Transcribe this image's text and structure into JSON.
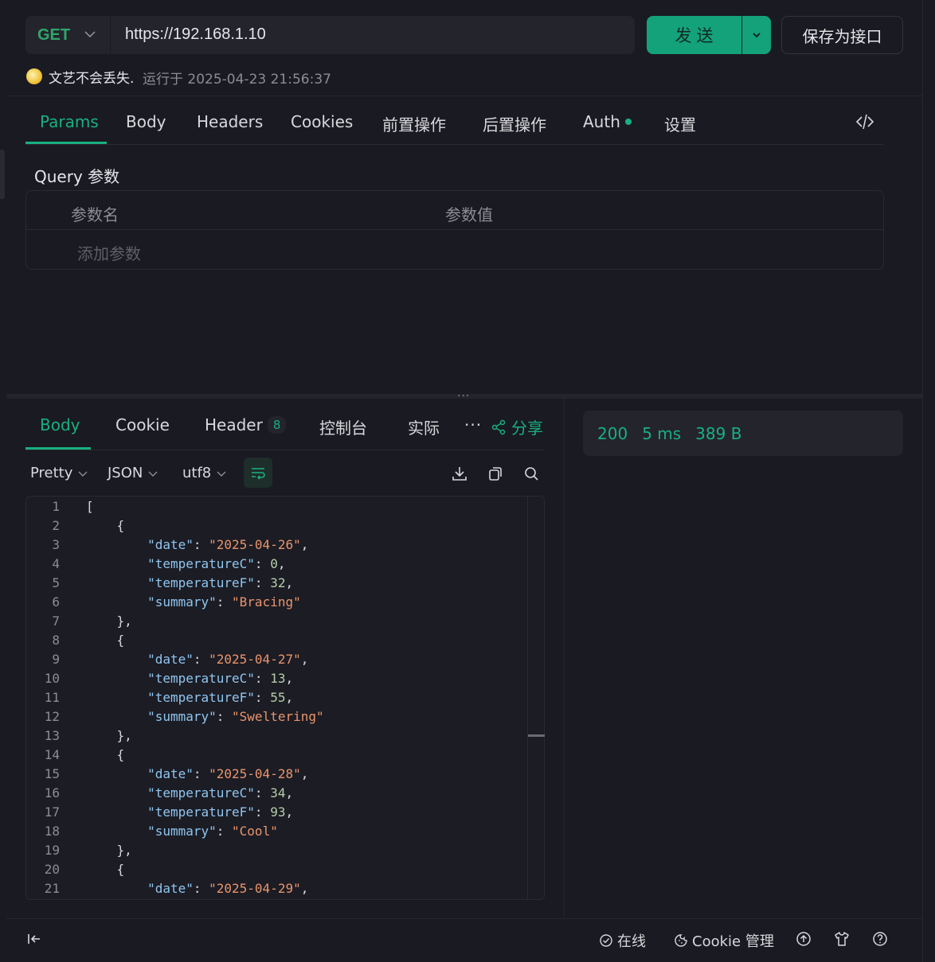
{
  "request": {
    "method": "GET",
    "url": "https://192.168.1.10",
    "send_label": "发送",
    "save_label": "保存为接口",
    "runner": "文艺不会丢失.",
    "run_meta": "运行于 2025-04-23 21:56:37"
  },
  "request_tabs": [
    "Params",
    "Body",
    "Headers",
    "Cookies",
    "前置操作",
    "后置操作",
    "Auth",
    "设置"
  ],
  "params": {
    "title": "Query 参数",
    "col_name": "参数名",
    "col_value": "参数值",
    "add_placeholder": "添加参数"
  },
  "response_tabs": {
    "body": "Body",
    "cookie": "Cookie",
    "header": "Header",
    "header_count": "8",
    "console": "控制台",
    "actual": "实际",
    "more": "···",
    "share": "分享"
  },
  "toolbar": {
    "format": "Pretty",
    "lang": "JSON",
    "encoding": "utf8"
  },
  "status": {
    "code": "200",
    "time": "5 ms",
    "size": "389 B"
  },
  "footer": {
    "online": "在线",
    "cookie_mgmt": "Cookie 管理"
  },
  "code_lines": [
    "[",
    "    {",
    "        \"date\": \"2025-04-26\",",
    "        \"temperatureC\": 0,",
    "        \"temperatureF\": 32,",
    "        \"summary\": \"Bracing\"",
    "    },",
    "    {",
    "        \"date\": \"2025-04-27\",",
    "        \"temperatureC\": 13,",
    "        \"temperatureF\": 55,",
    "        \"summary\": \"Sweltering\"",
    "    },",
    "    {",
    "        \"date\": \"2025-04-28\",",
    "        \"temperatureC\": 34,",
    "        \"temperatureF\": 93,",
    "        \"summary\": \"Cool\"",
    "    },",
    "    {",
    "        \"date\": \"2025-04-29\","
  ],
  "colors": {
    "accent": "#18b07f",
    "send": "#13a27a",
    "background": "#1a1a22",
    "json_key": "#8fc6f0",
    "json_string": "#e8956c",
    "json_number": "#b5cea8"
  },
  "icons": [
    "chevron-down-icon",
    "code-icon",
    "share-icon",
    "wrap-icon",
    "download-icon",
    "copy-icon",
    "search-icon",
    "collapse-sidebar-icon",
    "check-circle-icon",
    "cookie-icon",
    "upload-icon",
    "shirt-icon",
    "help-icon"
  ]
}
